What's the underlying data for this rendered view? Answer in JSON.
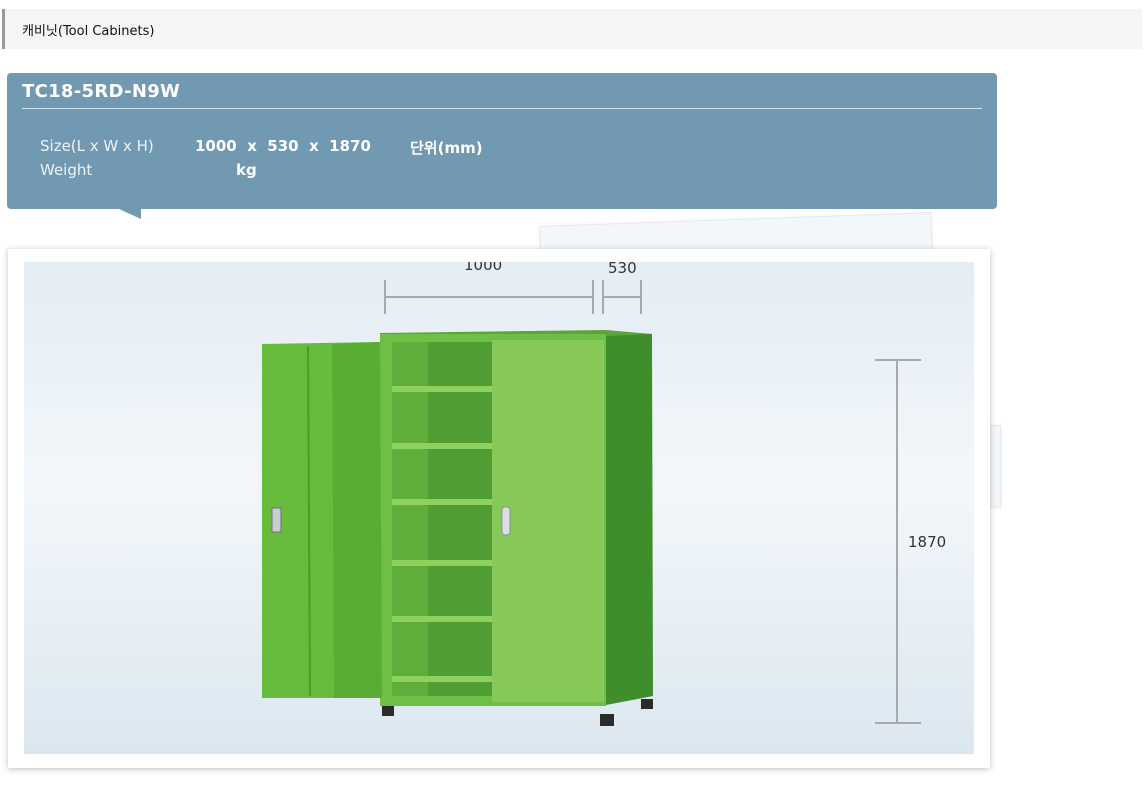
{
  "breadcrumb": {
    "label": "캐비닛(Tool Cabinets)"
  },
  "product": {
    "model": "TC18-5RD-N9W",
    "size_label": "Size(L x W x H)",
    "size_value": "1000  x  530  x  1870",
    "size_unit": "단위(mm)",
    "weight_label": "Weight",
    "weight_value": "kg"
  },
  "image": {
    "dim_width": "1000",
    "dim_depth": "530",
    "dim_height": "1870",
    "cabinet_color": "#7cc44a"
  }
}
